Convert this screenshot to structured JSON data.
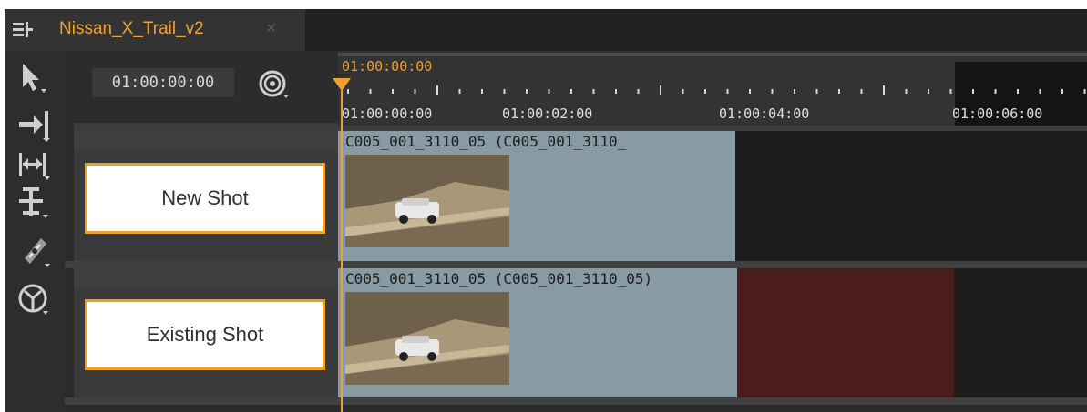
{
  "tab": {
    "title": "Nissan_X_Trail_v2",
    "close": "×",
    "icon": "timeline-icon"
  },
  "toolbar": {
    "tools": [
      {
        "name": "select-tool-icon"
      },
      {
        "name": "insert-tool-icon"
      },
      {
        "name": "slip-tool-icon"
      },
      {
        "name": "slide-tool-icon"
      },
      {
        "name": "razor-tool-icon"
      },
      {
        "name": "multi-tool-icon"
      }
    ]
  },
  "header": {
    "timecode": "01:00:00:00",
    "snap_icon": "snap-icon"
  },
  "ruler": {
    "current_timecode": "01:00:00:00",
    "labels": [
      "01:00:00:00",
      "01:00:02:00",
      "01:00:04:00",
      "01:00:06:00"
    ]
  },
  "tracks": [
    {
      "header_label": "New Shot",
      "clip_title": "C005_001_3110_05 (C005_001_3110_",
      "thumbnail": "car-on-dirt-road-thumbnail"
    },
    {
      "header_label": "Existing Shot",
      "clip_title": "C005_001_3110_05 (C005_001_3110_05)",
      "thumbnail": "car-on-dirt-road-thumbnail"
    }
  ],
  "colors": {
    "accent": "#f0a030",
    "clip": "#889aa3",
    "conflict": "#4b1c1c"
  }
}
